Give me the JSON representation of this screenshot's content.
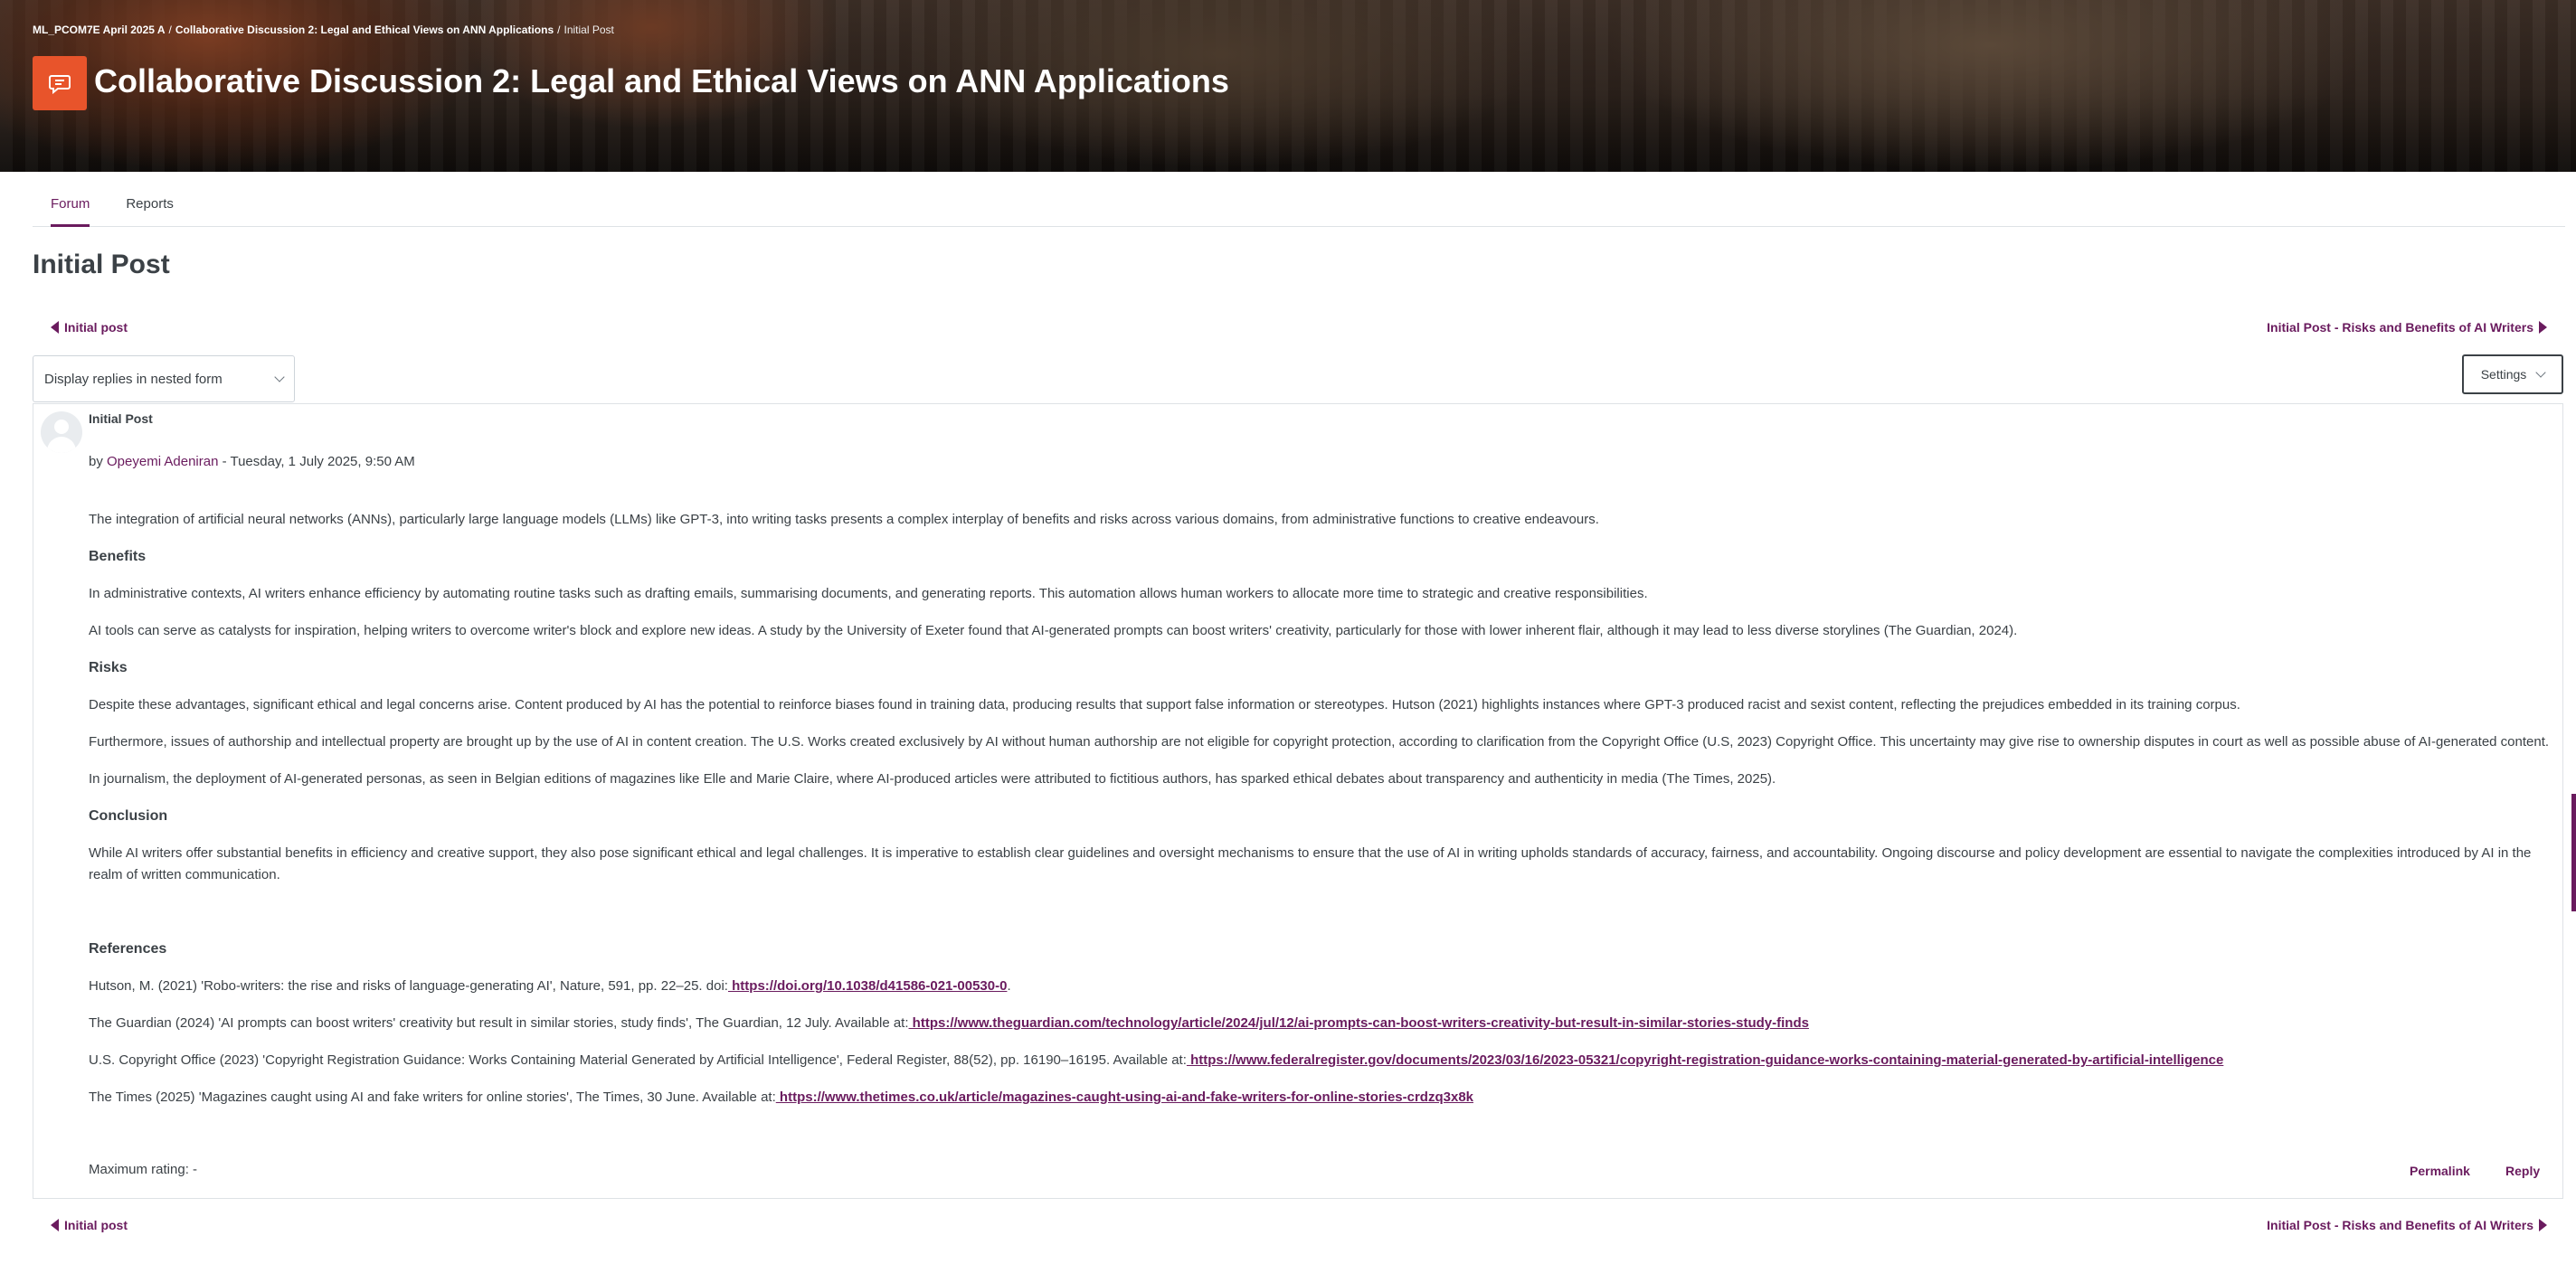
{
  "breadcrumb": {
    "course": "ML_PCOM7E April 2025 A",
    "forum": "Collaborative Discussion 2: Legal and Ethical Views on ANN Applications",
    "current": "Initial Post",
    "sep": "/"
  },
  "header": {
    "title": "Collaborative Discussion 2: Legal and Ethical Views on ANN Applications",
    "icon": "forum-chat-icon",
    "icon_color": "#e8542b"
  },
  "tabs": [
    {
      "label": "Forum",
      "active": true
    },
    {
      "label": "Reports",
      "active": false
    }
  ],
  "section_title": "Initial Post",
  "nav": {
    "prev_label": "Initial post",
    "next_label": "Initial Post - Risks and Benefits of AI Writers"
  },
  "display_mode": {
    "selected": "Display replies in nested form"
  },
  "settings_label": "Settings",
  "post": {
    "subject": "Initial Post",
    "by_prefix": "by",
    "author": "Opeyemi Adeniran",
    "date": "- Tuesday, 1 July 2025, 9:50 AM",
    "intro": "The integration of artificial neural networks (ANNs), particularly large language models (LLMs) like GPT-3, into writing tasks presents a complex interplay of benefits and risks across various domains, from administrative functions to creative endeavours.",
    "benefits_heading": "Benefits",
    "benefits_p1": "In administrative contexts, AI writers enhance efficiency by automating routine tasks such as drafting emails, summarising documents, and generating reports. This automation allows human workers to allocate more time to strategic and creative responsibilities.",
    "benefits_p2": "AI tools can serve as catalysts for inspiration, helping writers to overcome writer's block and explore new ideas. A study by the University of Exeter found that AI-generated prompts can boost writers' creativity, particularly for those with lower inherent flair, although it may lead to less diverse storylines (The Guardian, 2024).",
    "risks_heading": "Risks",
    "risks_p1": "Despite these advantages, significant ethical and legal concerns arise. Content produced by AI has the potential to reinforce biases found in training data, producing results that support false information or stereotypes. Hutson (2021) highlights instances where GPT-3 produced racist and sexist content, reflecting the prejudices embedded in its training corpus.",
    "risks_p2": "Furthermore, issues of authorship and intellectual property are brought up by the use of AI in content creation. The U.S. Works created exclusively by AI without human authorship are not eligible for copyright protection, according to clarification from the Copyright Office (U.S, 2023) Copyright Office. This uncertainty may give rise to ownership disputes in court as well as possible abuse of AI-generated content.",
    "risks_p3": "In journalism, the deployment of AI-generated personas, as seen in Belgian editions of magazines like Elle and Marie Claire, where AI-produced articles were attributed to fictitious authors, has sparked ethical debates about transparency and authenticity in media (The Times, 2025).",
    "conclusion_heading": "Conclusion",
    "conclusion_p": "While AI writers offer substantial benefits in efficiency and creative support, they also pose significant ethical and legal challenges. It is imperative to establish clear guidelines and oversight mechanisms to ensure that the use of AI in writing upholds standards of accuracy, fairness, and accountability. Ongoing discourse and policy development are essential to navigate the complexities introduced by AI in the realm of written communication.",
    "references_heading": "References",
    "refs": [
      {
        "text": "Hutson, M. (2021) 'Robo-writers: the rise and risks of language-generating AI', Nature, 591, pp. 22–25. doi:",
        "link": " https://doi.org/10.1038/d41586-021-00530-0",
        "tail": "."
      },
      {
        "text": "The Guardian (2024) 'AI prompts can boost writers' creativity but result in similar stories, study finds', The Guardian, 12 July. Available at:",
        "link": " https://www.theguardian.com/technology/article/2024/jul/12/ai-prompts-can-boost-writers-creativity-but-result-in-similar-stories-study-finds",
        "tail": ""
      },
      {
        "text": "U.S. Copyright Office (2023) 'Copyright Registration Guidance: Works Containing Material Generated by Artificial Intelligence', Federal Register, 88(52), pp. 16190–16195. Available at:",
        "link": " https://www.federalregister.gov/documents/2023/03/16/2023-05321/copyright-registration-guidance-works-containing-material-generated-by-artificial-intelligence",
        "tail": ""
      },
      {
        "text": "The Times (2025) 'Magazines caught using AI and fake writers for online stories', The Times, 30 June. Available at:",
        "link": " https://www.thetimes.co.uk/article/magazines-caught-using-ai-and-fake-writers-for-online-stories-crdzq3x8k",
        "tail": ""
      }
    ],
    "max_rating": "Maximum rating: -",
    "permalink_label": "Permalink",
    "reply_label": "Reply"
  },
  "colors": {
    "accent": "#6a1b5e",
    "icon_bg": "#e8542b",
    "text": "#3b4146"
  }
}
